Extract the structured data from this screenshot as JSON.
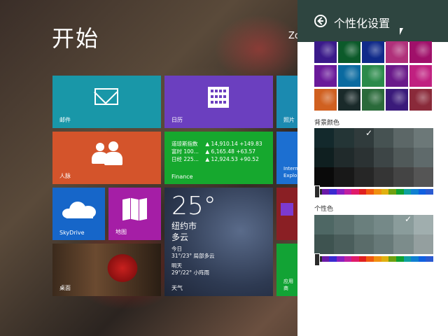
{
  "start": {
    "title": "开始",
    "user_fragment": "Zo"
  },
  "tiles": {
    "mail": {
      "label": "邮件",
      "color": "#1997a8"
    },
    "calendar": {
      "label": "日历",
      "color": "#6b3fbf"
    },
    "photos": {
      "label": "照片"
    },
    "people": {
      "label": "人脉",
      "color": "#d4542b"
    },
    "finance": {
      "label": "Finance",
      "rows": [
        {
          "name": "道琼斯指数",
          "value": "▲ 14,910.14 +149.83"
        },
        {
          "name": "富时 100...",
          "value": "▲ 6,165.48 +63.57"
        },
        {
          "name": "日经 225...",
          "value": "▲ 12,924.53 +90.52"
        }
      ]
    },
    "ie": {
      "label_line1": "Intern",
      "label_line2": "Explo"
    },
    "skydrive": {
      "label": "SkyDrive"
    },
    "maps": {
      "label": "地图"
    },
    "weather": {
      "temp": "25°",
      "city": "纽约市",
      "condition": "多云",
      "today_label": "今日",
      "today_forecast": "31°/23° 局部多云",
      "tomorrow_label": "明天",
      "tomorrow_forecast": "29°/22° 小阵雨",
      "label": "天气"
    },
    "desktop": {
      "label": "桌面"
    },
    "apps": {
      "label": "应用商"
    }
  },
  "panel": {
    "title": "个性化设置",
    "header_color": "#2e4540",
    "background_color_label": "背景颜色",
    "accent_color_label": "个性色",
    "patterns": [
      "#3a1a8a",
      "#0c5a2a",
      "#102a8a",
      "#b0307a",
      "#a0106a",
      "#6a1a9a",
      "#0a6aa0",
      "#2a8a4a",
      "#6a1a8a",
      "#c02080",
      "#d06020",
      "#1a2a2a",
      "#2a6a3a",
      "#3a1a7a",
      "#8a2a3a"
    ],
    "bg_swatches": [
      [
        "#13292c",
        "#243536",
        "#303b3c",
        "#465252",
        "#5c6767",
        "#6c7878"
      ],
      [
        "#0f1f20",
        "#202a2b",
        "#2b3233",
        "#3d4546",
        "#505959",
        "#5f6a6b"
      ],
      [
        "#0a0a0a",
        "#181818",
        "#262626",
        "#353535",
        "#444444",
        "#555555"
      ]
    ],
    "accent_swatches": [
      [
        "#4e6764",
        "#5b706e",
        "#6a7f7d",
        "#758988",
        "#8a9c9b",
        "#a0aeae"
      ],
      [
        "#3e5350",
        "#4a5d5b",
        "#5a6c6a",
        "#677978",
        "#7c8c8b",
        "#949f9f"
      ]
    ],
    "color_strip": [
      "#2a2a2a",
      "#6a1aa8",
      "#3a2ad0",
      "#8a20c0",
      "#c020a0",
      "#e01a6a",
      "#e02020",
      "#f05a10",
      "#f09010",
      "#e0b010",
      "#70a010",
      "#10a030",
      "#10a0a0",
      "#1080d0",
      "#1060e0",
      "#2a5ad0"
    ]
  }
}
